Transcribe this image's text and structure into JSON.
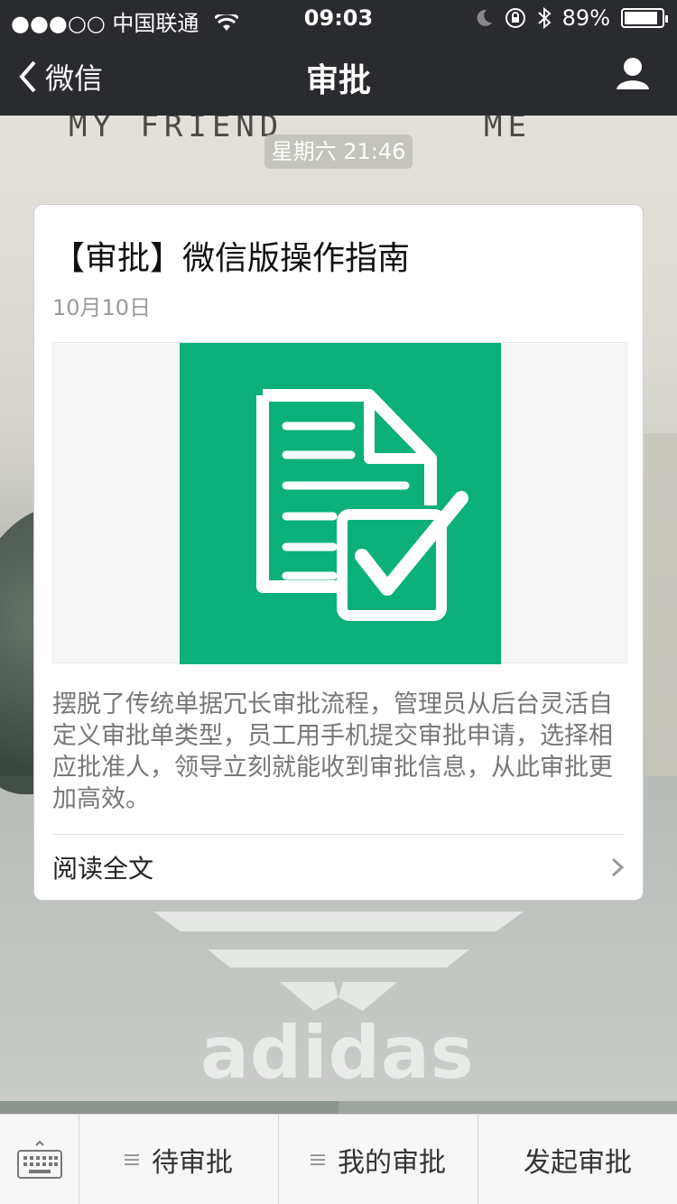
{
  "status_bar": {
    "carrier": "●●●○○ 中国联通",
    "time": "09:03",
    "battery": "89%",
    "battery_level": 0.89
  },
  "nav": {
    "back_label": "微信",
    "title": "审批"
  },
  "background": {
    "text_left": "MY FRIEND",
    "text_right": "ME",
    "logo_text": "adidas"
  },
  "chat": {
    "timestamp": "星期六 21:46"
  },
  "card": {
    "title": "【审批】微信版操作指南",
    "date": "10月10日",
    "description": "摆脱了传统单据冗长审批流程，管理员从后台灵活自定义审批单类型，员工用手机提交审批申请，选择相应批准人，领导立刻就能收到审批信息，从此审批更加高效。",
    "read_more": "阅读全文",
    "image_color": "#0bb07b"
  },
  "bottom_menu": {
    "items": [
      {
        "label": "待审批"
      },
      {
        "label": "我的审批"
      },
      {
        "label": "发起审批"
      }
    ]
  },
  "colors": {
    "nav_bg": "#2a2b2f",
    "accent_green": "#0bb07b"
  }
}
